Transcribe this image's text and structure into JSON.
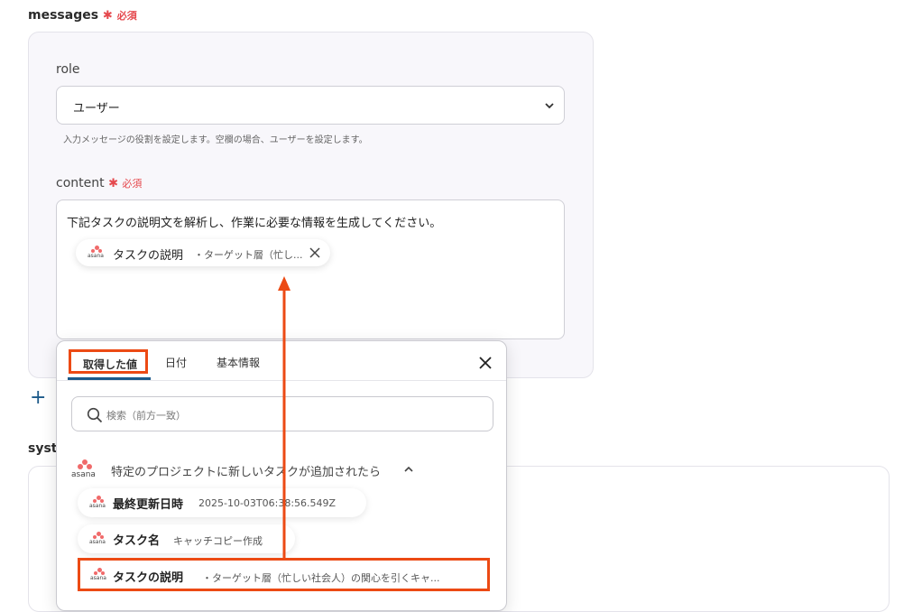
{
  "messages": {
    "label": "messages",
    "required_star": "✱",
    "required_text": "必須",
    "role": {
      "label": "role",
      "value": "ユーザー",
      "hint": "入力メッセージの役割を設定します。空欄の場合、ユーザーを設定します。"
    },
    "content": {
      "label": "content",
      "required_star": "✱",
      "required_text": "必須",
      "text": "下記タスクの説明文を解析し、作業に必要な情報を生成してください。",
      "chip": {
        "brand": "asana",
        "name": "タスクの説明",
        "value": "・ターゲット層（忙し..."
      }
    }
  },
  "add_button": "+",
  "system_label_partial": "syst",
  "dropdown": {
    "tabs": [
      {
        "label": "取得した値",
        "active": true
      },
      {
        "label": "日付",
        "active": false
      },
      {
        "label": "基本情報",
        "active": false
      }
    ],
    "search_placeholder": "検索（前方一致）",
    "group": {
      "brand": "asana",
      "title": "特定のプロジェクトに新しいタスクが追加されたら"
    },
    "items": [
      {
        "brand": "asana",
        "name": "最終更新日時",
        "value": "2025-10-03T06:38:56.549Z"
      },
      {
        "brand": "asana",
        "name": "タスク名",
        "value": "キャッチコピー作成"
      },
      {
        "brand": "asana",
        "name": "タスクの説明",
        "value": "・ターゲット層（忙しい社会人）の関心を引くキャ..."
      }
    ]
  },
  "colors": {
    "required": "#e5484d",
    "highlight": "#ec4a14",
    "asana": "#f06a6a",
    "tab_underline": "#1c5a8a"
  }
}
